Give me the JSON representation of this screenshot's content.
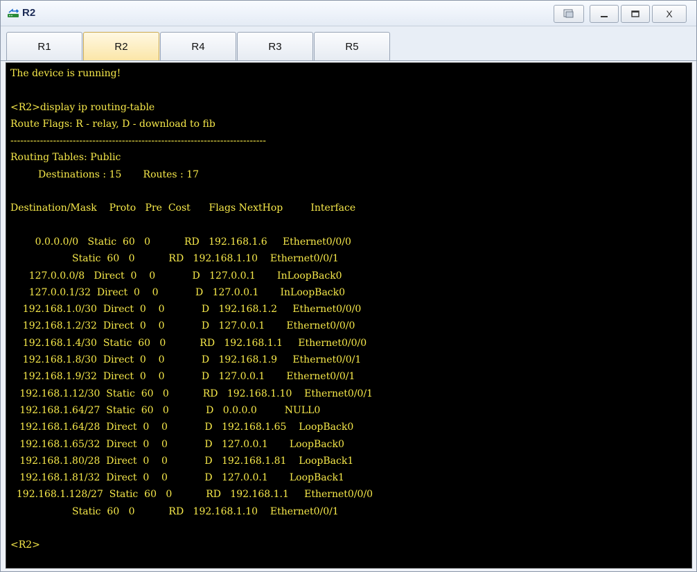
{
  "window": {
    "title": "R2",
    "controls": {
      "restore": "restore",
      "minimize": "–",
      "maximize": "□",
      "close": "X"
    }
  },
  "tabs": [
    {
      "label": "R1",
      "active": false
    },
    {
      "label": "R2",
      "active": true
    },
    {
      "label": "R4",
      "active": false
    },
    {
      "label": "R3",
      "active": false
    },
    {
      "label": "R5",
      "active": false
    }
  ],
  "terminal": {
    "status": "The device is running!",
    "prompt_command": "<R2>display ip routing-table",
    "route_flags": "Route Flags: R - relay, D - download to fib",
    "separator": "------------------------------------------------------------------------------",
    "tables_header": "Routing Tables: Public",
    "summary": "         Destinations : 15       Routes : 17",
    "columns": "Destination/Mask    Proto   Pre  Cost      Flags NextHop         Interface",
    "routes": [
      "        0.0.0.0/0   Static  60   0           RD   192.168.1.6     Ethernet0/0/0",
      "                    Static  60   0           RD   192.168.1.10    Ethernet0/0/1",
      "      127.0.0.0/8   Direct  0    0            D   127.0.0.1       InLoopBack0",
      "      127.0.0.1/32  Direct  0    0            D   127.0.0.1       InLoopBack0",
      "    192.168.1.0/30  Direct  0    0            D   192.168.1.2     Ethernet0/0/0",
      "    192.168.1.2/32  Direct  0    0            D   127.0.0.1       Ethernet0/0/0",
      "    192.168.1.4/30  Static  60   0           RD   192.168.1.1     Ethernet0/0/0",
      "    192.168.1.8/30  Direct  0    0            D   192.168.1.9     Ethernet0/0/1",
      "    192.168.1.9/32  Direct  0    0            D   127.0.0.1       Ethernet0/0/1",
      "   192.168.1.12/30  Static  60   0           RD   192.168.1.10    Ethernet0/0/1",
      "   192.168.1.64/27  Static  60   0            D   0.0.0.0         NULL0",
      "   192.168.1.64/28  Direct  0    0            D   192.168.1.65    LoopBack0",
      "   192.168.1.65/32  Direct  0    0            D   127.0.0.1       LoopBack0",
      "   192.168.1.80/28  Direct  0    0            D   192.168.1.81    LoopBack1",
      "   192.168.1.81/32  Direct  0    0            D   127.0.0.1       LoopBack1",
      "  192.168.1.128/27  Static  60   0           RD   192.168.1.1     Ethernet0/0/0",
      "                    Static  60   0           RD   192.168.1.10    Ethernet0/0/1"
    ],
    "final_prompt": "<R2>"
  },
  "colors": {
    "terminal_bg": "#000000",
    "terminal_text": "#f7e94a",
    "active_tab": "#fbe6a8"
  }
}
